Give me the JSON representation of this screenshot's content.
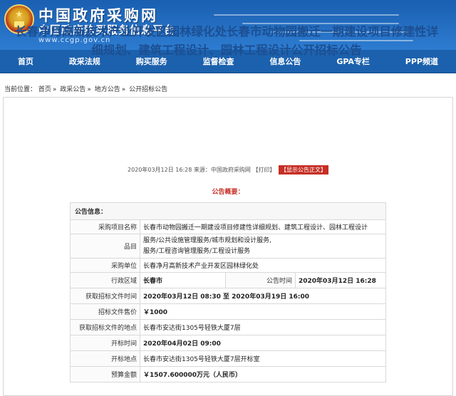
{
  "header": {
    "title": "中国政府采购网",
    "subtitle": "中国政府购买服务信息平台",
    "url": "www.ccgp.gov.cn"
  },
  "nav": {
    "items": [
      "首页",
      "政采法规",
      "购买服务",
      "监督检查",
      "信息公告",
      "GPA专栏",
      "PPP频道"
    ]
  },
  "breadcrumb": {
    "prefix": "当前位置：",
    "items": [
      "首页",
      "政采公告",
      "地方公告",
      "公开招标公告"
    ]
  },
  "article": {
    "title": "长春净月高新技术产业开发区园林绿化处长春市动物园搬迁一期建设项目修建性详细规划、建筑工程设计、园林工程设计公开招标公告",
    "date": "2020年03月12日 16:28",
    "source": "来源：中国政府采购网",
    "print_label": "【打印】",
    "show_label": "【显示公告正文】",
    "summary_heading": "公告概要："
  },
  "table": {
    "header": "公告信息：",
    "rows": [
      {
        "label": "采购项目名称",
        "value": "长春市动物园搬迁一期建设项目修建性详细规划、建筑工程设计、园林工程设计"
      },
      {
        "label": "品目",
        "value": "服务/公共设施管理服务/城市规划和设计服务,",
        "value2": "服务/工程咨询管理服务/工程设计服务"
      },
      {
        "label": "采购单位",
        "value": "长春净月高新技术产业开发区园林绿化处"
      },
      {
        "label": "行政区域",
        "value": "长春市",
        "label2": "公告时间",
        "value2": "2020年03月12日 16:28"
      },
      {
        "label": "获取招标文件时间",
        "value": "2020年03月12日 08:30 至 2020年03月19日 16:00"
      },
      {
        "label": "招标文件售价",
        "value": "￥1000"
      },
      {
        "label": "获取招标文件的地点",
        "value": "长春市安达街1305号轻铁大厦7层"
      },
      {
        "label": "开标时间",
        "value": "2020年04月02日 09:00"
      },
      {
        "label": "开标地点",
        "value": "长春市安达街1305号轻铁大厦7层开标室"
      },
      {
        "label": "预算金额",
        "value": "￥1507.600000万元（人民币）"
      }
    ]
  },
  "colors": {
    "header_blue": "#1a5fb0",
    "nav_blue": "#1c61ad",
    "title_blue": "#1c4f92",
    "accent_red": "#c62f26"
  }
}
